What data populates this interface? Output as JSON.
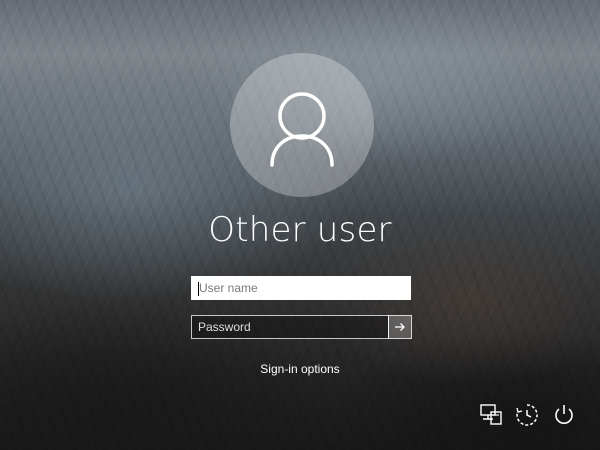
{
  "screen": "Windows sign-in",
  "user": {
    "display_name": "Other user"
  },
  "form": {
    "username_placeholder": "User name",
    "password_placeholder": "Password"
  },
  "links": {
    "sign_in_options": "Sign-in options"
  },
  "icons": {
    "avatar": "user-silhouette-icon",
    "submit": "arrow-right-icon",
    "network": "network-icon",
    "accessibility": "ease-of-access-icon",
    "power": "power-icon"
  },
  "colors": {
    "text": "#ffffff",
    "username_field_bg": "#ffffff",
    "password_field_bg": "rgba(0,0,0,0.28)"
  }
}
